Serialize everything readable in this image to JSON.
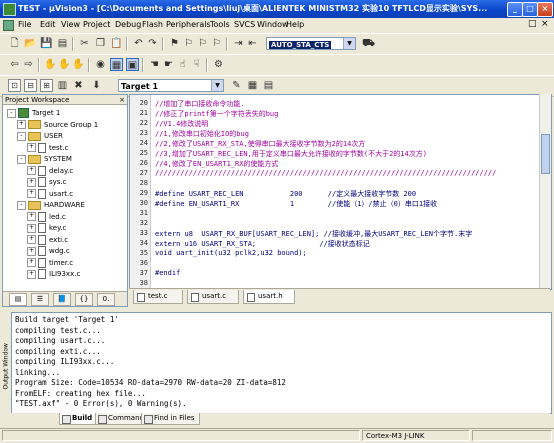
{
  "title_bar": {
    "title": "TEST - μVision3 - [C:\\Documents and Settings\\liuj\\桌面\\ALIENTEK MINISTM32 实验10 TFTLCD显示实验\\SYS...",
    "min_label": "_",
    "max_label": "□",
    "close_label": "×"
  },
  "menu": [
    "File",
    "Edit",
    "View",
    "Project",
    "Debug",
    "Flash",
    "Peripherals",
    "Tools",
    "SVCS",
    "Window",
    "Help"
  ],
  "toolbar": {
    "find_value": "AUTO_STA_CTS",
    "target_value": "Target 1"
  },
  "project": {
    "header": "Project Workspace",
    "close_label": "×",
    "tree": [
      {
        "label": "Target 1",
        "kind": "target",
        "level": 0,
        "sign": "-"
      },
      {
        "label": "Source Group 1",
        "kind": "folder",
        "level": 1,
        "sign": "+"
      },
      {
        "label": "USER",
        "kind": "folder",
        "level": 1,
        "sign": "-"
      },
      {
        "label": "test.c",
        "kind": "file",
        "level": 2,
        "sign": "+"
      },
      {
        "label": "SYSTEM",
        "kind": "folder",
        "level": 1,
        "sign": "-"
      },
      {
        "label": "delay.c",
        "kind": "file",
        "level": 2,
        "sign": "+"
      },
      {
        "label": "sys.c",
        "kind": "file",
        "level": 2,
        "sign": "+"
      },
      {
        "label": "usart.c",
        "kind": "file",
        "level": 2,
        "sign": "+"
      },
      {
        "label": "HARDWARE",
        "kind": "folder",
        "level": 1,
        "sign": "-"
      },
      {
        "label": "led.c",
        "kind": "file",
        "level": 2,
        "sign": "+"
      },
      {
        "label": "key.c",
        "kind": "file",
        "level": 2,
        "sign": "+"
      },
      {
        "label": "exti.c",
        "kind": "file",
        "level": 2,
        "sign": "+"
      },
      {
        "label": "wdg.c",
        "kind": "file",
        "level": 2,
        "sign": "+"
      },
      {
        "label": "timer.c",
        "kind": "file",
        "level": 2,
        "sign": "+"
      },
      {
        "label": "ILI93xx.c",
        "kind": "file",
        "level": 2,
        "sign": "+"
      }
    ]
  },
  "editor": {
    "lines": [
      {
        "n": "20",
        "text": "//增加了串口接收命令功能.",
        "cls": "c-comment"
      },
      {
        "n": "21",
        "text": "//修正了printf第一个字符丢失的bug",
        "cls": "c-comment"
      },
      {
        "n": "22",
        "text": "//V1.4修改说明",
        "cls": "c-comment"
      },
      {
        "n": "23",
        "text": "//1,修改串口初始化IO的bug",
        "cls": "c-comment"
      },
      {
        "n": "24",
        "text": "//2,修改了USART_RX_STA,使得串口最大接收字节数为2的14次方",
        "cls": "c-comment"
      },
      {
        "n": "25",
        "text": "//3,增加了USART_REC_LEN,用于定义串口最大允许接收的字节数(不大于2的14次方)",
        "cls": "c-comment"
      },
      {
        "n": "26",
        "text": "//4,修改了EN_USART1_RX的使能方式",
        "cls": "c-comment"
      },
      {
        "n": "27",
        "text": "/////////////////////////////////////////////////////////////////////////////////",
        "cls": "c-comment"
      },
      {
        "n": "28",
        "text": "",
        "cls": ""
      },
      {
        "n": "29",
        "text": "#define USART_REC_LEN           200      //定义最大接收字节数 200",
        "cls": "c-kw"
      },
      {
        "n": "30",
        "text": "#define EN_USART1_RX            1        //使能（1）/禁止（0）串口1接收",
        "cls": "c-kw"
      },
      {
        "n": "31",
        "text": "",
        "cls": ""
      },
      {
        "n": "32",
        "text": "",
        "cls": ""
      },
      {
        "n": "33",
        "text": "extern u8  USART_RX_BUF[USART_REC_LEN]; //接收缓冲,最大USART_REC_LEN个字节.末字",
        "cls": "c-kw"
      },
      {
        "n": "34",
        "text": "extern u16 USART_RX_STA;               //接收状态标记",
        "cls": "c-kw"
      },
      {
        "n": "35",
        "text": "void uart_init(u32 pclk2,u32 bound);",
        "cls": "c-kw"
      },
      {
        "n": "36",
        "text": "",
        "cls": ""
      },
      {
        "n": "37",
        "text": "#endif",
        "cls": "c-kw"
      },
      {
        "n": "38",
        "text": "",
        "cls": ""
      }
    ]
  },
  "file_tabs": [
    "test.c",
    "usart.c",
    "usart.h"
  ],
  "output": {
    "side_label": "Output Window",
    "lines": [
      "Build target 'Target 1'",
      "compiling test.c...",
      "compiling usart.c...",
      "compiling exti.c...",
      "compiling ILI93xx.c...",
      "linking...",
      "Program Size: Code=10534 RO-data=2970 RW-data=20 ZI-data=812",
      "FromELF: creating hex file...",
      "\"TEST.axf\" - 0 Error(s), 0 Warning(s)."
    ],
    "tabs": [
      "Build",
      "Command",
      "Find in Files"
    ]
  },
  "status": {
    "device": "Cortex-M3 J-LINK"
  }
}
